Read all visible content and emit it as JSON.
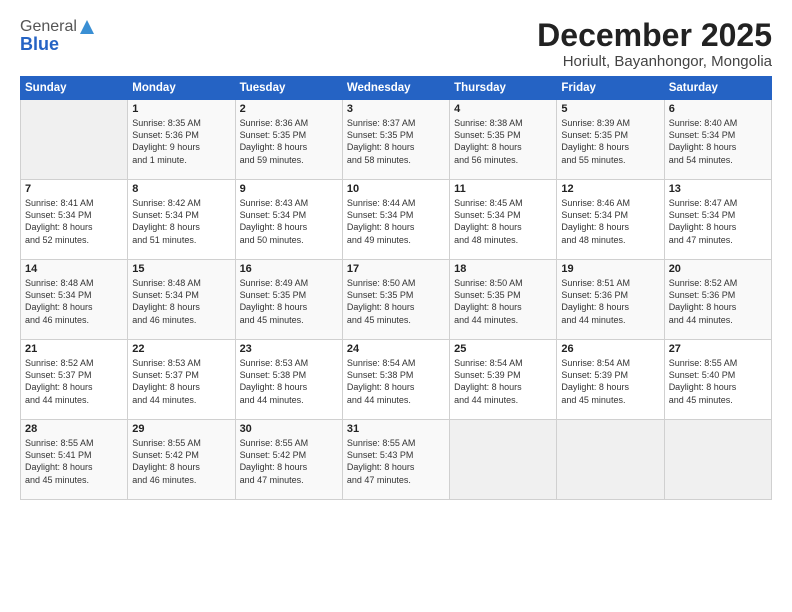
{
  "logo": {
    "general": "General",
    "blue": "Blue"
  },
  "title": "December 2025",
  "subtitle": "Horiult, Bayanhongor, Mongolia",
  "days_header": [
    "Sunday",
    "Monday",
    "Tuesday",
    "Wednesday",
    "Thursday",
    "Friday",
    "Saturday"
  ],
  "weeks": [
    [
      {
        "num": "",
        "info": ""
      },
      {
        "num": "1",
        "info": "Sunrise: 8:35 AM\nSunset: 5:36 PM\nDaylight: 9 hours\nand 1 minute."
      },
      {
        "num": "2",
        "info": "Sunrise: 8:36 AM\nSunset: 5:35 PM\nDaylight: 8 hours\nand 59 minutes."
      },
      {
        "num": "3",
        "info": "Sunrise: 8:37 AM\nSunset: 5:35 PM\nDaylight: 8 hours\nand 58 minutes."
      },
      {
        "num": "4",
        "info": "Sunrise: 8:38 AM\nSunset: 5:35 PM\nDaylight: 8 hours\nand 56 minutes."
      },
      {
        "num": "5",
        "info": "Sunrise: 8:39 AM\nSunset: 5:35 PM\nDaylight: 8 hours\nand 55 minutes."
      },
      {
        "num": "6",
        "info": "Sunrise: 8:40 AM\nSunset: 5:34 PM\nDaylight: 8 hours\nand 54 minutes."
      }
    ],
    [
      {
        "num": "7",
        "info": "Sunrise: 8:41 AM\nSunset: 5:34 PM\nDaylight: 8 hours\nand 52 minutes."
      },
      {
        "num": "8",
        "info": "Sunrise: 8:42 AM\nSunset: 5:34 PM\nDaylight: 8 hours\nand 51 minutes."
      },
      {
        "num": "9",
        "info": "Sunrise: 8:43 AM\nSunset: 5:34 PM\nDaylight: 8 hours\nand 50 minutes."
      },
      {
        "num": "10",
        "info": "Sunrise: 8:44 AM\nSunset: 5:34 PM\nDaylight: 8 hours\nand 49 minutes."
      },
      {
        "num": "11",
        "info": "Sunrise: 8:45 AM\nSunset: 5:34 PM\nDaylight: 8 hours\nand 48 minutes."
      },
      {
        "num": "12",
        "info": "Sunrise: 8:46 AM\nSunset: 5:34 PM\nDaylight: 8 hours\nand 48 minutes."
      },
      {
        "num": "13",
        "info": "Sunrise: 8:47 AM\nSunset: 5:34 PM\nDaylight: 8 hours\nand 47 minutes."
      }
    ],
    [
      {
        "num": "14",
        "info": "Sunrise: 8:48 AM\nSunset: 5:34 PM\nDaylight: 8 hours\nand 46 minutes."
      },
      {
        "num": "15",
        "info": "Sunrise: 8:48 AM\nSunset: 5:34 PM\nDaylight: 8 hours\nand 46 minutes."
      },
      {
        "num": "16",
        "info": "Sunrise: 8:49 AM\nSunset: 5:35 PM\nDaylight: 8 hours\nand 45 minutes."
      },
      {
        "num": "17",
        "info": "Sunrise: 8:50 AM\nSunset: 5:35 PM\nDaylight: 8 hours\nand 45 minutes."
      },
      {
        "num": "18",
        "info": "Sunrise: 8:50 AM\nSunset: 5:35 PM\nDaylight: 8 hours\nand 44 minutes."
      },
      {
        "num": "19",
        "info": "Sunrise: 8:51 AM\nSunset: 5:36 PM\nDaylight: 8 hours\nand 44 minutes."
      },
      {
        "num": "20",
        "info": "Sunrise: 8:52 AM\nSunset: 5:36 PM\nDaylight: 8 hours\nand 44 minutes."
      }
    ],
    [
      {
        "num": "21",
        "info": "Sunrise: 8:52 AM\nSunset: 5:37 PM\nDaylight: 8 hours\nand 44 minutes."
      },
      {
        "num": "22",
        "info": "Sunrise: 8:53 AM\nSunset: 5:37 PM\nDaylight: 8 hours\nand 44 minutes."
      },
      {
        "num": "23",
        "info": "Sunrise: 8:53 AM\nSunset: 5:38 PM\nDaylight: 8 hours\nand 44 minutes."
      },
      {
        "num": "24",
        "info": "Sunrise: 8:54 AM\nSunset: 5:38 PM\nDaylight: 8 hours\nand 44 minutes."
      },
      {
        "num": "25",
        "info": "Sunrise: 8:54 AM\nSunset: 5:39 PM\nDaylight: 8 hours\nand 44 minutes."
      },
      {
        "num": "26",
        "info": "Sunrise: 8:54 AM\nSunset: 5:39 PM\nDaylight: 8 hours\nand 45 minutes."
      },
      {
        "num": "27",
        "info": "Sunrise: 8:55 AM\nSunset: 5:40 PM\nDaylight: 8 hours\nand 45 minutes."
      }
    ],
    [
      {
        "num": "28",
        "info": "Sunrise: 8:55 AM\nSunset: 5:41 PM\nDaylight: 8 hours\nand 45 minutes."
      },
      {
        "num": "29",
        "info": "Sunrise: 8:55 AM\nSunset: 5:42 PM\nDaylight: 8 hours\nand 46 minutes."
      },
      {
        "num": "30",
        "info": "Sunrise: 8:55 AM\nSunset: 5:42 PM\nDaylight: 8 hours\nand 47 minutes."
      },
      {
        "num": "31",
        "info": "Sunrise: 8:55 AM\nSunset: 5:43 PM\nDaylight: 8 hours\nand 47 minutes."
      },
      {
        "num": "",
        "info": ""
      },
      {
        "num": "",
        "info": ""
      },
      {
        "num": "",
        "info": ""
      }
    ]
  ]
}
